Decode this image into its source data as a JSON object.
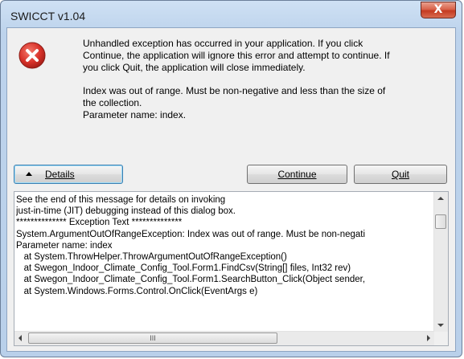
{
  "window": {
    "title": "SWICCT v1.04",
    "close_symbol": "X"
  },
  "icons": {
    "error": "error-icon",
    "close": "close-icon"
  },
  "message": {
    "lines": [
      "Unhandled exception has occurred in your application. If you click",
      "Continue, the application will ignore this error and attempt to continue. If",
      "you click Quit, the application will close immediately."
    ],
    "detail_lines": [
      "Index was out of range. Must be non-negative and less than the size of",
      "the collection.",
      "Parameter name: index."
    ]
  },
  "buttons": {
    "details_label": "Details",
    "continue_label": "Continue",
    "quit_label": "Quit"
  },
  "details_text": {
    "lines": [
      "See the end of this message for details on invoking",
      "just-in-time (JIT) debugging instead of this dialog box.",
      "",
      "************** Exception Text **************",
      "System.ArgumentOutOfRangeException: Index was out of range. Must be non-negati",
      "Parameter name: index",
      "   at System.ThrowHelper.ThrowArgumentOutOfRangeException()",
      "   at Swegon_Indoor_Climate_Config_Tool.Form1.FindCsv(String[] files, Int32 rev)",
      "   at Swegon_Indoor_Climate_Config_Tool.Form1.SearchButton_Click(Object sender,",
      "   at System.Windows.Forms.Control.OnClick(EventArgs e)"
    ]
  },
  "scrollbars": {
    "horizontal_grip": "III"
  },
  "colors": {
    "error_red": "#d8322a",
    "close_red": "#c94a30",
    "focus_blue": "#3c7fb1"
  }
}
